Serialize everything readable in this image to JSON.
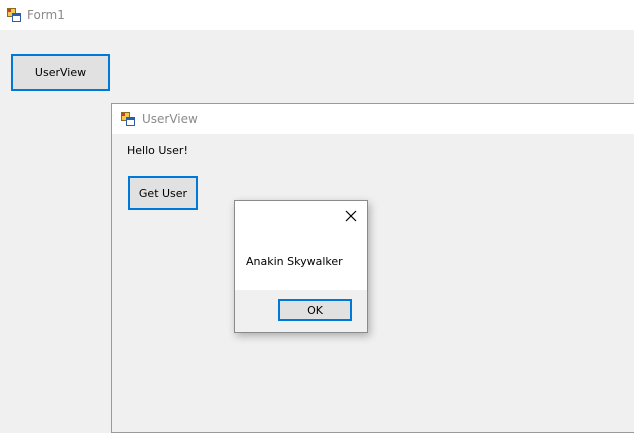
{
  "form1": {
    "title": "Form1",
    "userview_button_label": "UserView"
  },
  "userview": {
    "title": "UserView",
    "greeting": "Hello User!",
    "get_user_button_label": "Get User"
  },
  "messagebox": {
    "message": "Anakin Skywalker",
    "ok_label": "OK",
    "close_icon": "close-icon"
  },
  "icons": {
    "app_icon": "winforms-app-icon"
  },
  "colors": {
    "focus_border": "#0078d7",
    "button_face": "#e1e1e1",
    "window_bg": "#f0f0f0",
    "titlebar_bg": "#ffffff",
    "title_text_inactive": "#8a8a8a"
  }
}
